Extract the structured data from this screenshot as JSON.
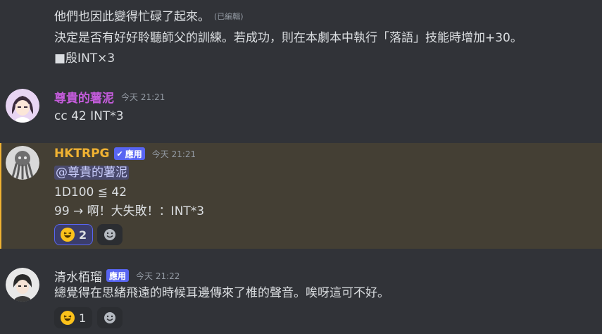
{
  "messages": [
    {
      "lines": [
        "他們也因此變得忙碌了起來。",
        "決定是否有好好聆聽師父的訓練。若成功，則在本劇本中執行「落語」技能時增加+30。",
        "■殷INT×3"
      ],
      "edited": "(已編輯)"
    },
    {
      "username": "尊貴的薯泥",
      "username_color": "#c45cdb",
      "timestamp": "今天 21:21",
      "lines": [
        "cc 42 INT*3"
      ]
    },
    {
      "username": "HKTRPG",
      "username_color": "#f0b232",
      "badge": "應用",
      "badge_check": "✔",
      "timestamp": "今天 21:21",
      "mention": "@尊貴的薯泥",
      "lines": [
        "1D100 ≦ 42",
        "99 → 啊！大失敗！：INT*3"
      ],
      "reactions": [
        {
          "emoji": "laughing-face",
          "count": "2",
          "me": true
        }
      ]
    },
    {
      "username": "清水栢瑠",
      "username_color": "#dbdee1",
      "badge": "應用",
      "timestamp": "今天 21:22",
      "lines": [
        "總覺得在思緒飛遠的時候耳邊傳來了椎的聲音。唉呀這可不好。"
      ],
      "reactions": [
        {
          "emoji": "laughing-face",
          "count": "1",
          "me": false
        }
      ]
    }
  ],
  "colors": {
    "background": "#313338",
    "highlight": "#443f34",
    "highlight_bar": "#f0b232",
    "badge": "#5865f2"
  }
}
